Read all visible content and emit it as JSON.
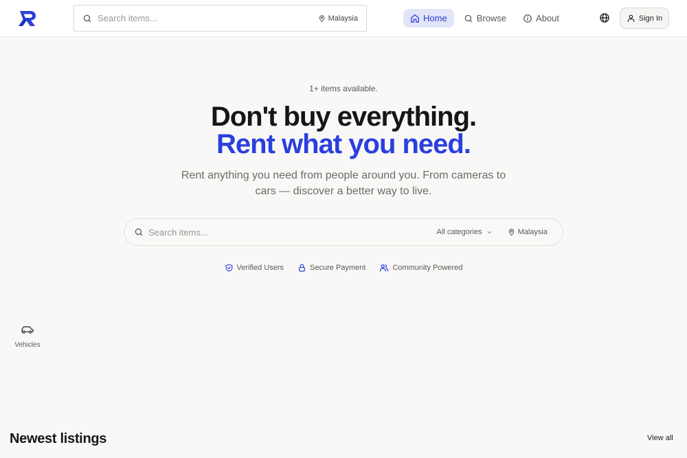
{
  "header": {
    "search": {
      "placeholder": "Search items...",
      "location": "Malaysia"
    },
    "nav": [
      {
        "label": "Home",
        "icon": "home-icon",
        "active": true
      },
      {
        "label": "Browse",
        "icon": "search-icon",
        "active": false
      },
      {
        "label": "About",
        "icon": "info-icon",
        "active": false
      }
    ],
    "sign_in": "Sign In"
  },
  "hero": {
    "availability": "1+ items available.",
    "title_line1": "Don't buy everything.",
    "title_line2": "Rent what you need.",
    "subtitle": "Rent anything you need from people around you. From cameras to cars — discover a better way to live.",
    "search": {
      "placeholder": "Search items...",
      "category": "All categories",
      "location": "Malaysia"
    },
    "badges": [
      {
        "label": "Verified Users",
        "icon": "shield-check-icon"
      },
      {
        "label": "Secure Payment",
        "icon": "lock-icon"
      },
      {
        "label": "Community Powered",
        "icon": "users-icon"
      }
    ]
  },
  "categories": [
    {
      "label": "Vehicles",
      "icon": "car-icon"
    }
  ],
  "newest": {
    "title": "Newest listings",
    "view_all": "View all"
  },
  "colors": {
    "accent": "#2a3fe0",
    "nav_active_bg": "#e2e4f8",
    "background": "#f9f8f7"
  }
}
